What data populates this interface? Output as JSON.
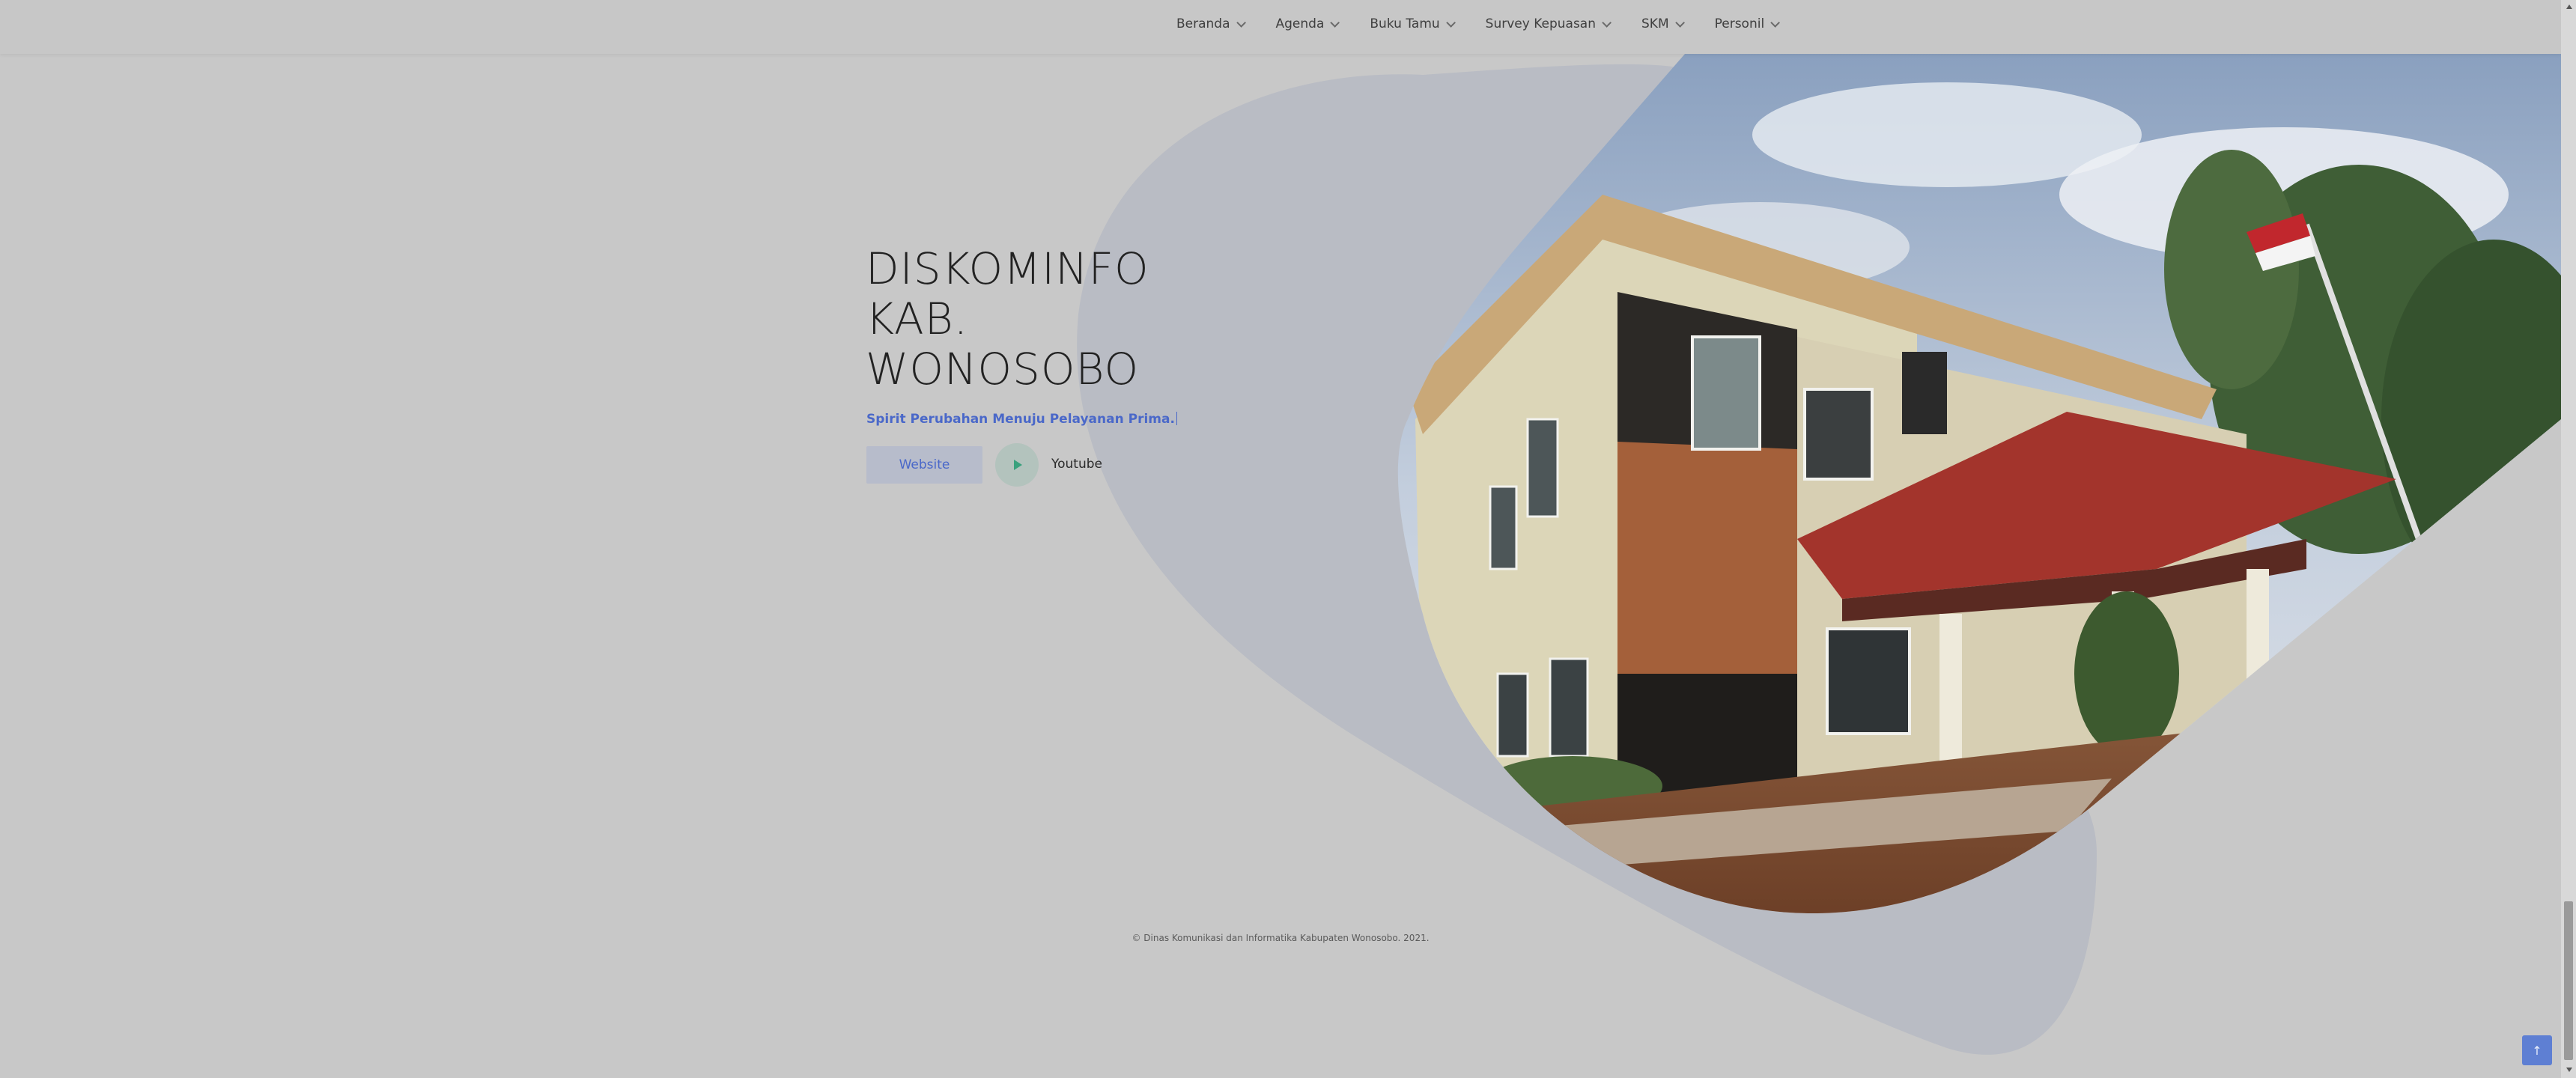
{
  "nav": {
    "items": [
      {
        "label": "Beranda"
      },
      {
        "label": "Agenda"
      },
      {
        "label": "Buku Tamu"
      },
      {
        "label": "Survey Kepuasan"
      },
      {
        "label": "SKM"
      },
      {
        "label": "Personil"
      }
    ]
  },
  "hero": {
    "title_lines": [
      "DISKOMINFO",
      "KAB.",
      "WONOSOBO"
    ],
    "tagline": "Spirit Perubahan Menuju Pelayanan Prima.",
    "website_button": "Website",
    "youtube_label": "Youtube"
  },
  "footer": {
    "copyright": "© Dinas Komunikasi dan Informatika Kabupaten Wonosobo. 2021."
  },
  "back_to_top_icon": "arrow-up-icon",
  "colors": {
    "accent": "#4a68c9",
    "play": "#3aa17d",
    "background": "#c8c8c8",
    "blob": "#b9bcc4"
  }
}
